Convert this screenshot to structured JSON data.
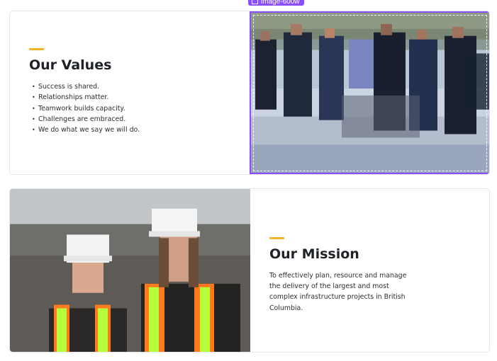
{
  "colors": {
    "accent": "#f0b429",
    "selection": "#8a4fff",
    "heading": "#1f2328",
    "border": "#e4e6ea"
  },
  "selection_tag": {
    "icon": "image-frame-icon",
    "label": "image-600w"
  },
  "values_section": {
    "title": "Our Values",
    "items": [
      "Success is shared.",
      "Relationships matter.",
      "Teamwork builds capacity.",
      "Challenges are embraced.",
      "We do what we say we will do."
    ],
    "image_alt": "team-photo"
  },
  "mission_section": {
    "title": "Our Mission",
    "body": "To effectively plan, resource and manage the delivery of the largest and most complex infrastructure projects in British Columbia.",
    "image_alt": "workers-photo"
  }
}
